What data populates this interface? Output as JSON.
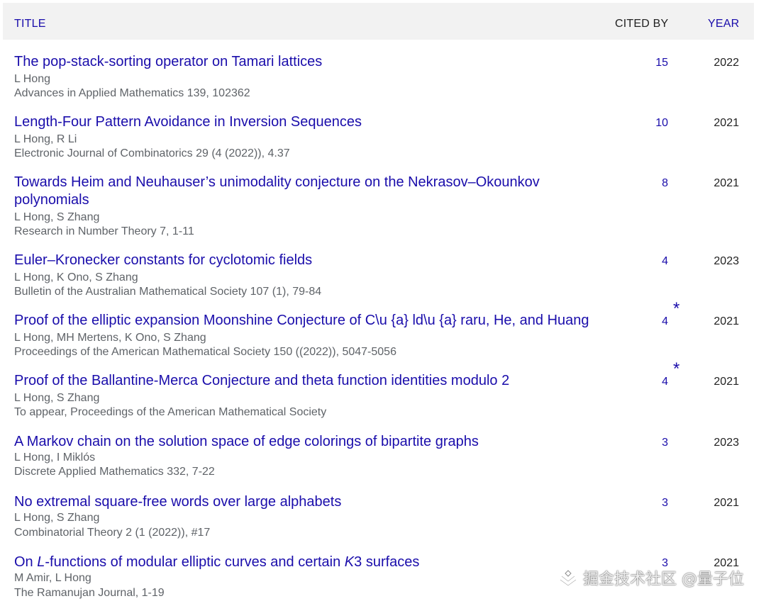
{
  "header": {
    "title": "TITLE",
    "cited_by": "CITED BY",
    "year": "YEAR"
  },
  "articles": [
    {
      "title": "The pop-stack-sorting operator on Tamari lattices",
      "authors": "L Hong",
      "venue": "Advances in Applied Mathematics 139, 102362",
      "cited_by": "15",
      "year": "2022"
    },
    {
      "title": "Length-Four Pattern Avoidance in Inversion Sequences",
      "authors": "L Hong, R Li",
      "venue": "Electronic Journal of Combinatorics 29 (4 (2022)), 4.37",
      "cited_by": "10",
      "year": "2021"
    },
    {
      "title": "Towards Heim and Neuhauser’s unimodality conjecture on the Nekrasov–Okounkov polynomials",
      "authors": "L Hong, S Zhang",
      "venue": "Research in Number Theory 7, 1-11",
      "cited_by": "8",
      "year": "2021"
    },
    {
      "title": "Euler–Kronecker constants for cyclotomic fields",
      "authors": "L Hong, K Ono, S Zhang",
      "venue": "Bulletin of the Australian Mathematical Society 107 (1), 79-84",
      "cited_by": "4",
      "year": "2023"
    },
    {
      "title": "Proof of the elliptic expansion Moonshine Conjecture of C\\u {a} ld\\u {a} raru, He, and Huang",
      "authors": "L Hong, MH Mertens, K Ono, S Zhang",
      "venue": "Proceedings of the American Mathematical Society 150 ((2022)), 5047-5056",
      "cited_by": "4",
      "star": "*",
      "year": "2021"
    },
    {
      "title": "Proof of the Ballantine-Merca Conjecture and theta function identities modulo 2",
      "authors": "L Hong, S Zhang",
      "venue": "To appear, Proceedings of the American Mathematical Society",
      "cited_by": "4",
      "star": "*",
      "year": "2021"
    },
    {
      "title": "A Markov chain on the solution space of edge colorings of bipartite graphs",
      "authors": "L Hong, I Miklós",
      "venue": "Discrete Applied Mathematics 332, 7-22",
      "cited_by": "3",
      "year": "2023"
    },
    {
      "title": "No extremal square-free words over large alphabets",
      "authors": "L Hong, S Zhang",
      "venue": "Combinatorial Theory 2 (1 (2022)), #17",
      "cited_by": "3",
      "year": "2021"
    },
    {
      "title_parts": [
        "On ",
        "L",
        "-functions of modular elliptic curves and certain ",
        "K",
        "3 surfaces"
      ],
      "authors": "M Amir, L Hong",
      "venue": "The Ramanujan Journal, 1-19",
      "cited_by": "3",
      "year": "2021"
    }
  ],
  "watermark": {
    "text": "掘金技术社区 @量子位",
    "icon": "juejin-logo-icon"
  },
  "colors": {
    "link": "#1a0dab",
    "meta": "#5f6368",
    "header_bg": "#f2f2f2"
  }
}
